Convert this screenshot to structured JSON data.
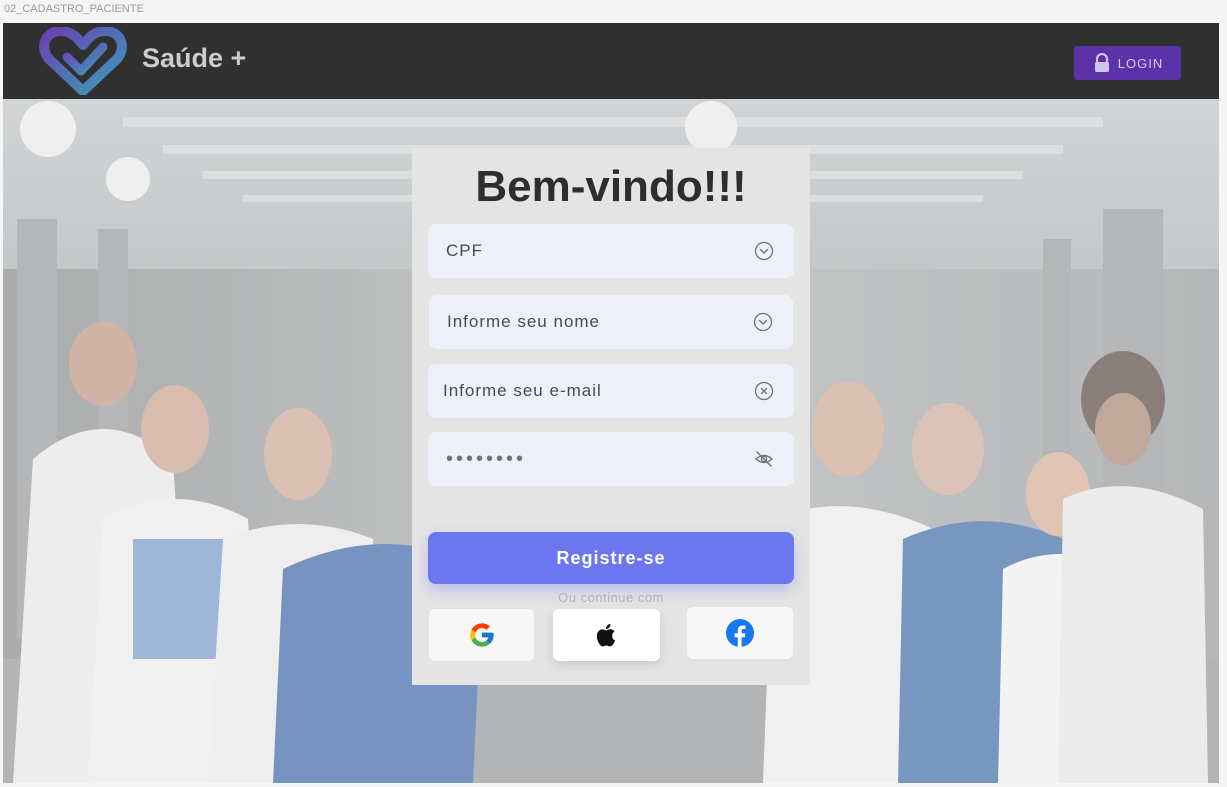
{
  "frame": {
    "label": "02_CADASTRO_PACIENTE"
  },
  "header": {
    "brand": "Saúde +",
    "login_label": "LOGIN",
    "colors": {
      "bar": "#303030",
      "login": "#5b33a6",
      "logo_start": "#6b3fb3",
      "logo_end": "#3aa0b8"
    }
  },
  "card": {
    "title": "Bem-vindo!!!",
    "fields": {
      "cpf": {
        "placeholder": "CPF",
        "icon": "chevron-circle-down-icon"
      },
      "name": {
        "placeholder": "Informe seu nome",
        "icon": "chevron-circle-down-icon"
      },
      "email": {
        "placeholder": "Informe seu e-mail",
        "icon": "clear-circle-icon"
      },
      "password": {
        "value": "••••••••",
        "icon": "eye-off-icon"
      }
    },
    "register_label": "Registre-se",
    "alt_label": "Ou continue com",
    "social": [
      {
        "name": "google",
        "icon": "google-icon"
      },
      {
        "name": "apple",
        "icon": "apple-icon"
      },
      {
        "name": "facebook",
        "icon": "facebook-icon"
      }
    ],
    "colors": {
      "primary": "#6c77ef",
      "field_bg": "#edf0f8",
      "card_bg": "#e4e4e4"
    }
  }
}
